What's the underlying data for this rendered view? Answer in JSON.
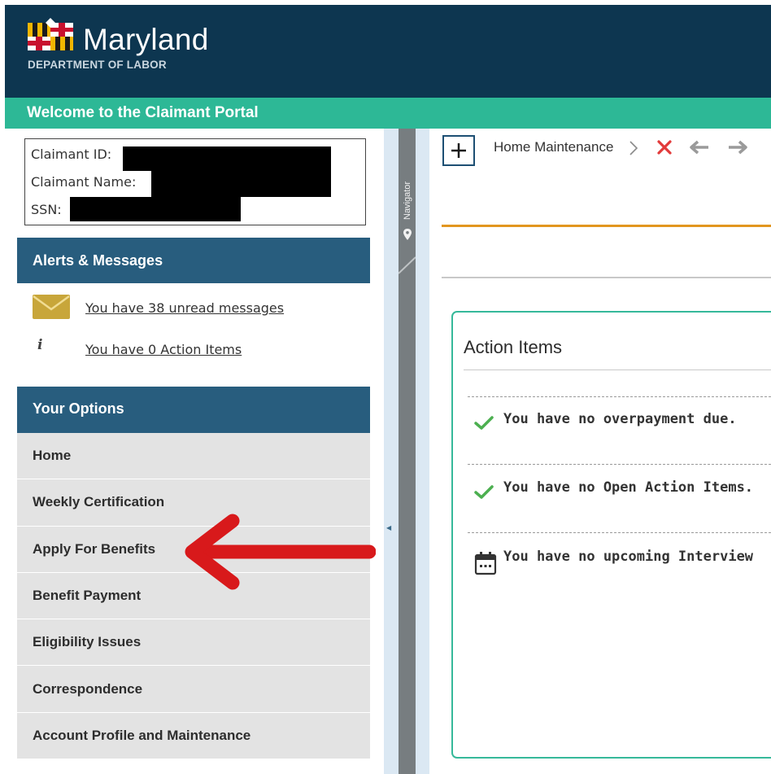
{
  "header": {
    "brand": "Maryland",
    "subtitle": "DEPARTMENT OF LABOR",
    "welcome": "Welcome to the Claimant Portal",
    "colors": {
      "header_bg": "#0d3650",
      "welcome_bg": "#2db896"
    }
  },
  "claimant": {
    "id_label": "Claimant ID:",
    "name_label": "Claimant Name:",
    "ssn_label": "SSN:"
  },
  "alerts": {
    "title": "Alerts & Messages",
    "messages_icon": "envelope-icon",
    "messages_link": "You have 38 unread messages",
    "actions_icon": "info-icon",
    "info_glyph": "i",
    "actions_link": "You have 0 Action Items"
  },
  "options": {
    "title": "Your Options",
    "items": [
      "Home",
      "Weekly Certification",
      "Apply For Benefits",
      "Benefit Payment",
      "Eligibility Issues",
      "Correspondence",
      "Account Profile and Maintenance"
    ]
  },
  "navigator": {
    "label": "Navigator",
    "icon": "map-pin-icon"
  },
  "toolbar": {
    "add_icon": "plus-icon",
    "tab_label": "Home Maintenance",
    "close_icon": "close-icon",
    "back_icon": "arrow-left-icon",
    "forward_icon": "arrow-right-icon"
  },
  "action_items": {
    "title": "Action Items",
    "items": [
      {
        "icon": "checkmark-icon",
        "text": "You have no overpayment due."
      },
      {
        "icon": "checkmark-icon",
        "text": "You have no Open Action Items."
      },
      {
        "icon": "calendar-icon",
        "text": "You have no upcoming Interview"
      }
    ]
  },
  "annotation": {
    "icon": "red-arrow-icon",
    "color": "#d8191b"
  }
}
